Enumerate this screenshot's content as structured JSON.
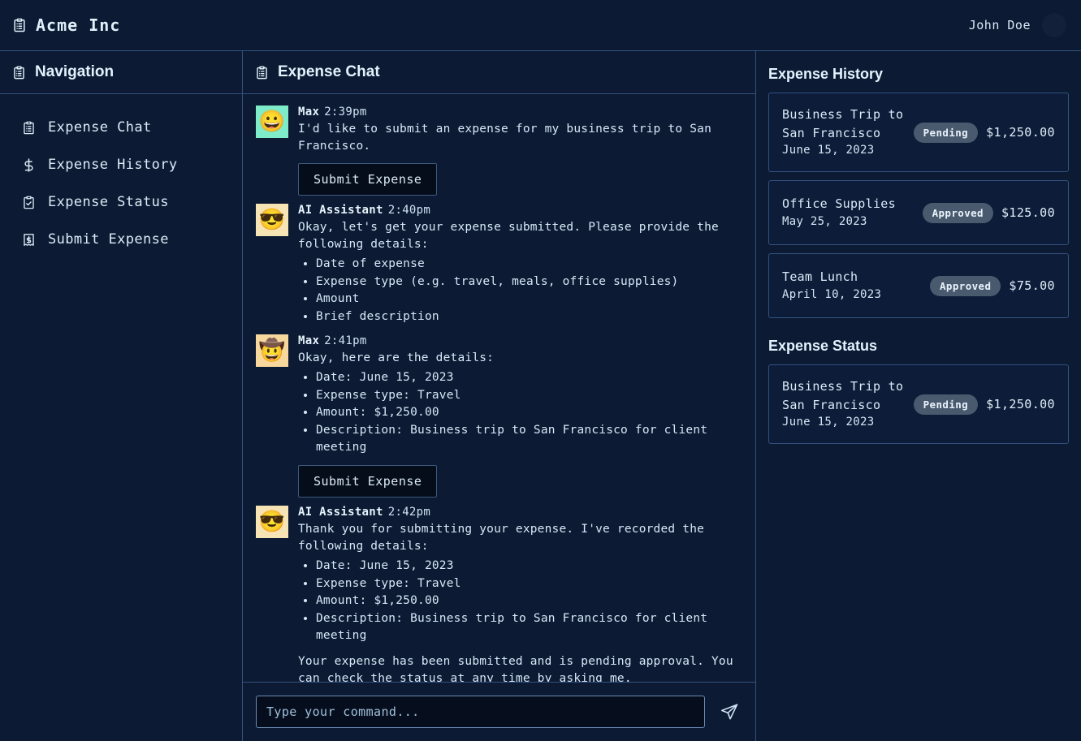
{
  "topbar": {
    "brand_icon": "clipboard-list-icon",
    "brand_name": "Acme Inc",
    "user_name": "John Doe",
    "avatar_icon": "user-avatar"
  },
  "sidebar": {
    "header_icon": "clipboard-list-icon",
    "header_title": "Navigation",
    "items": [
      {
        "label": "Expense Chat",
        "icon": "clipboard-list-icon"
      },
      {
        "label": "Expense History",
        "icon": "dollar-sign-icon"
      },
      {
        "label": "Expense Status",
        "icon": "clipboard-check-icon"
      },
      {
        "label": "Submit Expense",
        "icon": "receipt-dollar-icon"
      }
    ]
  },
  "chat": {
    "header_icon": "clipboard-list-icon",
    "header_title": "Expense Chat",
    "messages": [
      {
        "author": "Max",
        "time": "2:39pm",
        "avatar_emoji": "😀",
        "avatar_bg": "#7eecc8",
        "text": "I'd like to submit an expense for my business trip to San Francisco.",
        "bullets": [],
        "trailing_text": "",
        "button": "Submit Expense"
      },
      {
        "author": "AI Assistant",
        "time": "2:40pm",
        "avatar_emoji": "😎",
        "avatar_bg": "#f7e4b4",
        "text": "Okay, let's get your expense submitted. Please provide the following details:",
        "bullets": [
          "Date of expense",
          "Expense type (e.g. travel, meals, office supplies)",
          "Amount",
          "Brief description"
        ],
        "trailing_text": "",
        "button": ""
      },
      {
        "author": "Max",
        "time": "2:41pm",
        "avatar_emoji": "🤠",
        "avatar_bg": "#f7d79b",
        "text": "Okay, here are the details:",
        "bullets": [
          "Date: June 15, 2023",
          "Expense type: Travel",
          "Amount: $1,250.00",
          "Description: Business trip to San Francisco for client meeting"
        ],
        "trailing_text": "",
        "button": "Submit Expense"
      },
      {
        "author": "AI Assistant",
        "time": "2:42pm",
        "avatar_emoji": "😎",
        "avatar_bg": "#f7e4b4",
        "text": "Thank you for submitting your expense. I've recorded the following details:",
        "bullets": [
          "Date: June 15, 2023",
          "Expense type: Travel",
          "Amount: $1,250.00",
          "Description: Business trip to San Francisco for client meeting"
        ],
        "trailing_text": "Your expense has been submitted and is pending approval. You can check the status at any time by asking me.",
        "button": ""
      }
    ],
    "composer": {
      "placeholder": "Type your command...",
      "value": "",
      "send_icon": "send-paper-plane-icon"
    }
  },
  "right_panel": {
    "history_title": "Expense History",
    "history": [
      {
        "title": "Business Trip to\nSan Francisco",
        "date": "June 15, 2023",
        "status": "Pending",
        "status_color": "#4a5a6e",
        "amount": "$1,250.00"
      },
      {
        "title": "Office Supplies",
        "date": "May 25, 2023",
        "status": "Approved",
        "status_color": "#4a5a6e",
        "amount": "$125.00"
      },
      {
        "title": "Team Lunch",
        "date": "April 10, 2023",
        "status": "Approved",
        "status_color": "#4a5a6e",
        "amount": "$75.00"
      }
    ],
    "status_title": "Expense Status",
    "status_items": [
      {
        "title": "Business Trip to\nSan Francisco",
        "date": "June 15, 2023",
        "status": "Pending",
        "status_color": "#4a5a6e",
        "amount": "$1,250.00"
      }
    ]
  },
  "theme": {
    "bg": "#0b1830",
    "panel_bg": "#0c1a33",
    "border": "#34527f",
    "text": "#dbeafe",
    "button_bg": "#050d1b"
  }
}
